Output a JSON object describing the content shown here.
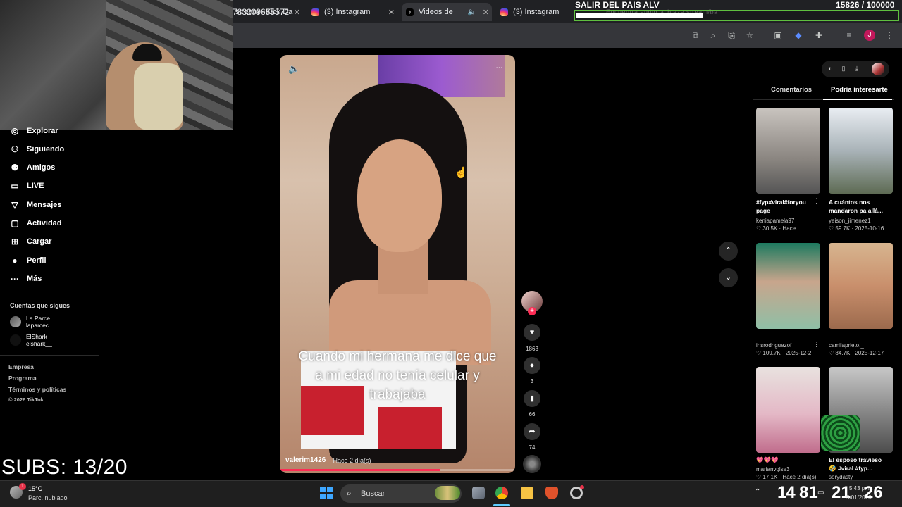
{
  "browser": {
    "tabs": [
      {
        "label": "stream - Kick Da",
        "close": "✕",
        "icon": "kick"
      },
      {
        "label": "(3) Instagram",
        "close": "✕",
        "icon": "instagram"
      },
      {
        "label": "Videos de",
        "close": "✕",
        "icon": "tiktok",
        "active": true
      },
      {
        "label": "(3) Instagram",
        "close": "",
        "icon": "instagram"
      }
    ],
    "ghost_tabs": "Encuentra audio   ✕   blaze.stream/ba",
    "url": "783209655572",
    "profile_initial": "J"
  },
  "stream_overlay": {
    "goal_title": "SALIR DEL PAIS ALV",
    "goal_count": "15826 / 100000",
    "goal_fraction": 0.158,
    "subs": "SUBS: 13/20"
  },
  "sidebar": {
    "items": [
      {
        "label": "Explorar",
        "icon": "compass-icon"
      },
      {
        "label": "Siguiendo",
        "icon": "following-icon"
      },
      {
        "label": "Amigos",
        "icon": "friends-icon"
      },
      {
        "label": "LIVE",
        "icon": "live-icon"
      },
      {
        "label": "Mensajes",
        "icon": "messages-icon"
      },
      {
        "label": "Actividad",
        "icon": "activity-icon"
      },
      {
        "label": "Cargar",
        "icon": "upload-icon"
      },
      {
        "label": "Perfil",
        "icon": "profile-icon"
      },
      {
        "label": "Más",
        "icon": "more-icon"
      }
    ],
    "following_title": "Cuentas que sigues",
    "following": [
      {
        "name": "La Parce",
        "handle": "laparcec"
      },
      {
        "name": "ElShark",
        "handle": "elshark__"
      }
    ],
    "footer": [
      "Empresa",
      "Programa",
      "Términos y políticas",
      "© 2026 TikTok"
    ]
  },
  "video": {
    "caption": "Cuando mi hermana me dice que a mi edad no tenía celular y trabajaba",
    "author": "valerim1426",
    "posted": "· Hace 2 día(s)",
    "progress": 0.68,
    "likes": "1863",
    "comments": "3",
    "saves": "66",
    "shares": "74"
  },
  "right_panel": {
    "tab_comments": "Comentarios",
    "tab_interesting": "Podría interesarte",
    "items": [
      {
        "title": "#fyp#viral#foryou page",
        "user": "keniapamela97",
        "meta": "♡ 30.5K · Hace..."
      },
      {
        "title": "A cuántos nos mandaron pa allá...",
        "user": "yeison_jimenez1",
        "meta": "♡ 59.7K · 2025-10-16"
      },
      {
        "title": "",
        "user": "irisrodriguezof",
        "meta": "♡ 109.7K · 2025-12-2"
      },
      {
        "title": "",
        "user": "camilaprieto._",
        "meta": "♡ 84.7K · 2025-12-17"
      },
      {
        "title": "💖💖💖",
        "user": "marianvglse3",
        "meta": "♡ 17.1K · Hace 2 día(s)"
      },
      {
        "title": "El esposo travieso 🤣 #viral #fyp...",
        "user": "sorydasty",
        "meta": ""
      }
    ]
  },
  "taskbar": {
    "weather_temp": "15°C",
    "weather_desc": "Parc. nublado",
    "weather_badge": "1",
    "search_label": "Buscar",
    "overlay_left": "14",
    "overlay_mid": "81",
    "overlay_right1": "21",
    "overlay_right2": "26",
    "clock": "5:43 p.m.",
    "date": "5/01/2026"
  }
}
